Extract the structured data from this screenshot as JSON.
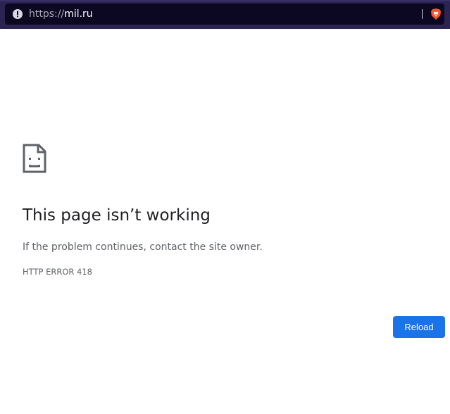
{
  "browser": {
    "address_bar": {
      "scheme": "https://",
      "host": "mil.ru",
      "security_icon": "info-circle-icon",
      "shield_icon": "brave-shield-icon"
    }
  },
  "error_page": {
    "icon": "sad-page-icon",
    "title": "This page isn’t working",
    "message": "If the problem continues, contact the site owner.",
    "code": "HTTP ERROR 418",
    "reload_label": "Reload"
  },
  "colors": {
    "toolbar": "#2b2350",
    "urlbar": "#0c0822",
    "button": "#1a73e8",
    "title": "#202124",
    "text": "#5f6368"
  }
}
